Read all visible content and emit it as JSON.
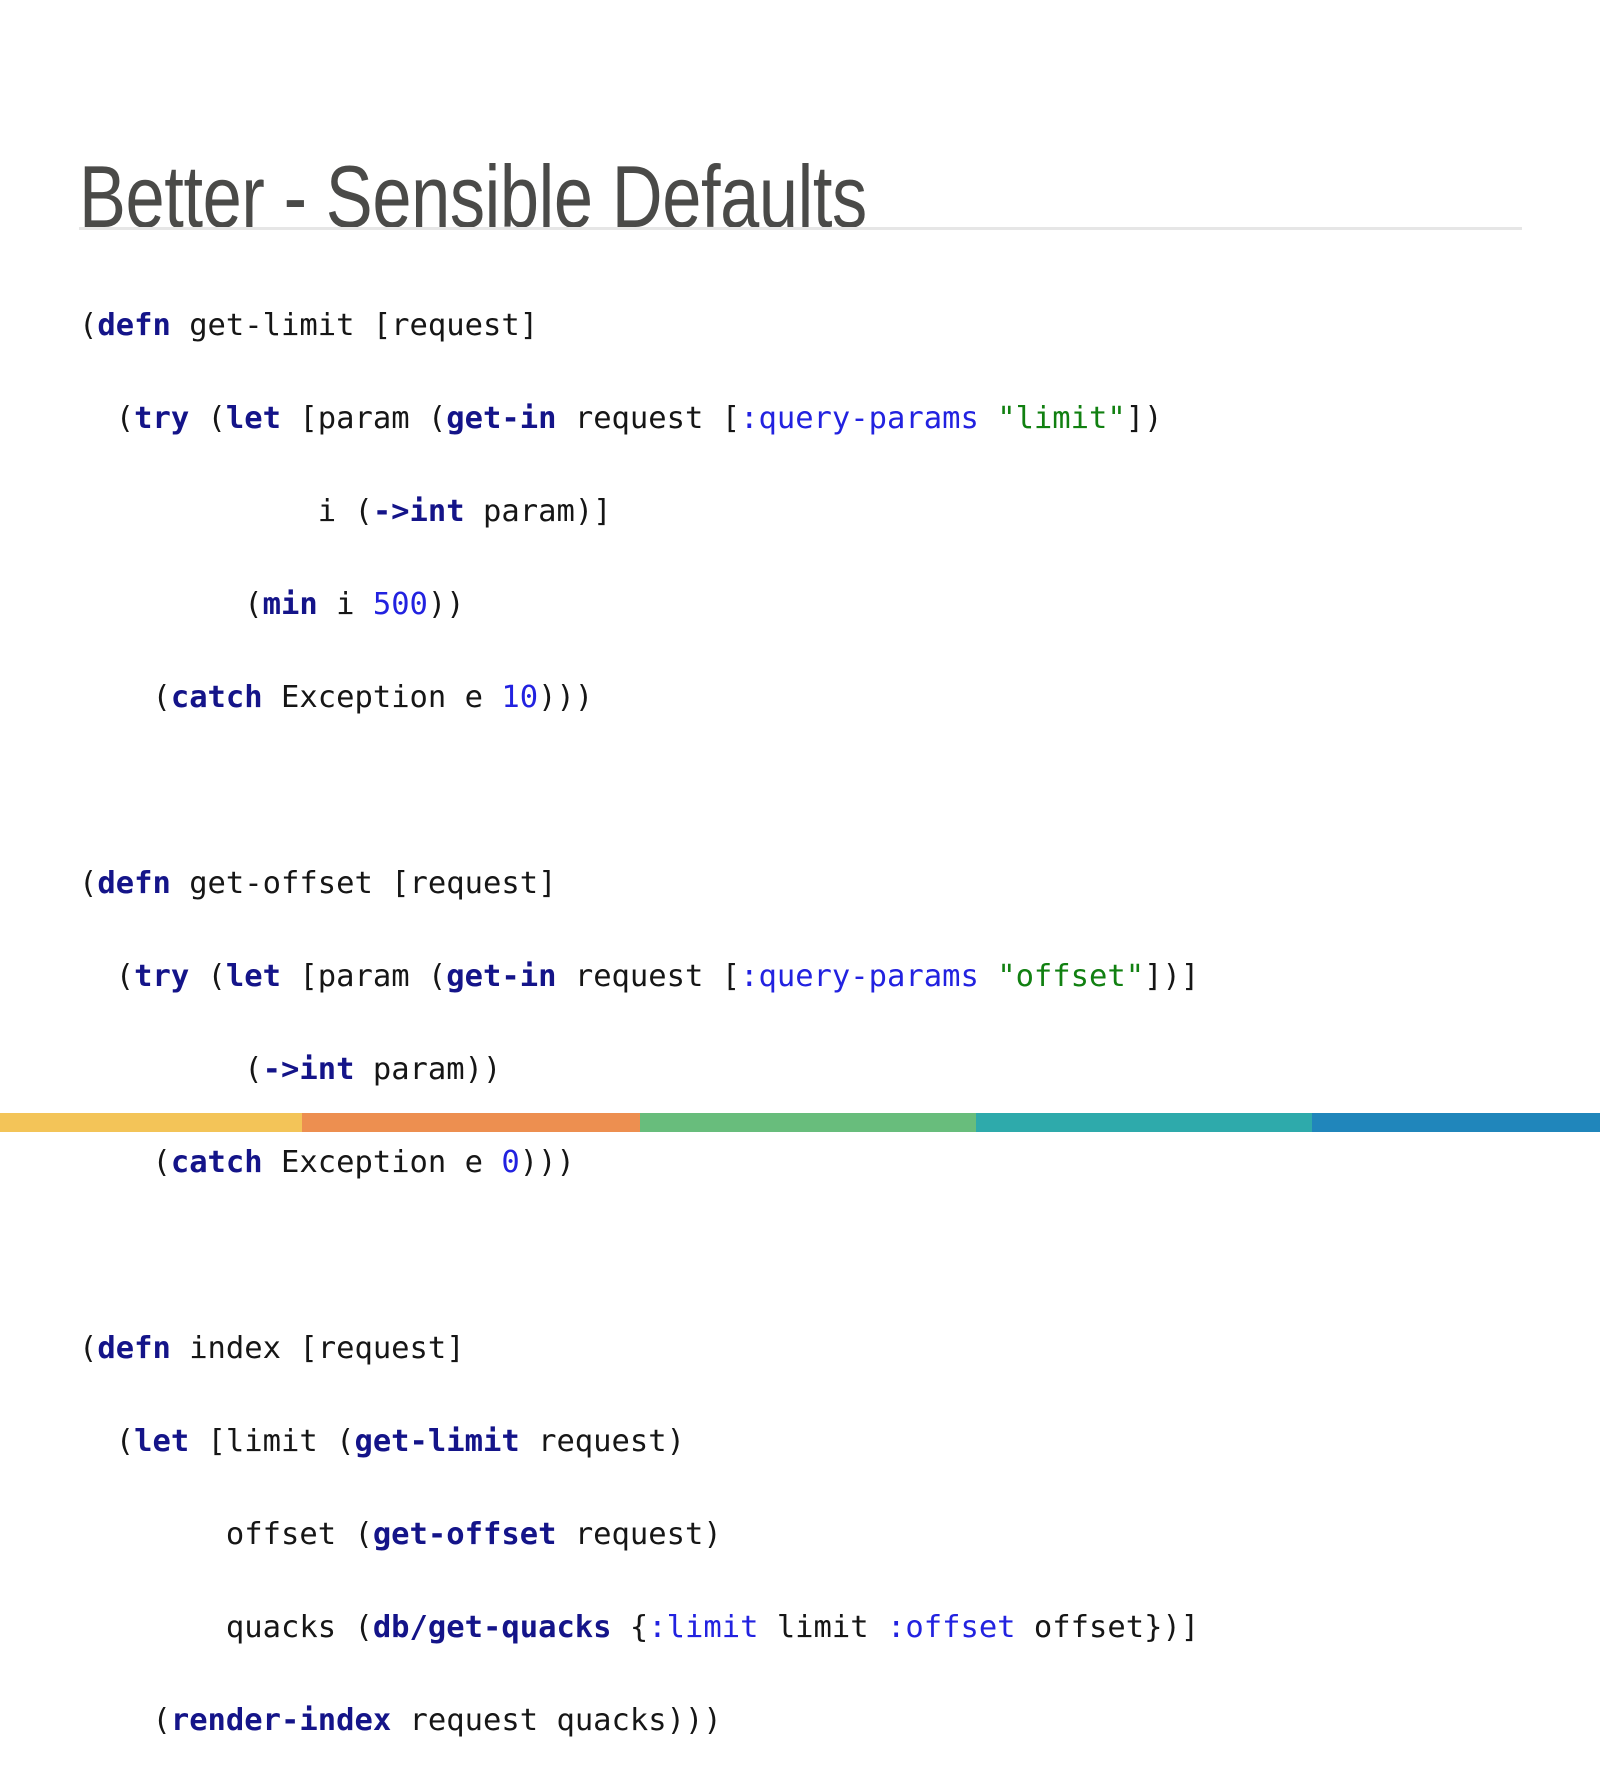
{
  "slide": {
    "title": "Better - Sensible Defaults",
    "title_color": "#4a4a48",
    "rule_color": "#e6e6e6",
    "background": "#ffffff"
  },
  "theme": {
    "keyword_bold_navy": "#141489",
    "keyword_literal_blue": "#2222e0",
    "number_blue": "#2222e0",
    "string_green": "#118011",
    "plain_text": "#161616"
  },
  "code": {
    "language": "clojure",
    "full_text": "(defn get-limit [request]\n  (try (let [param (get-in request [:query-params \"limit\"])\n             i (->int param)]\n         (min i 500))\n    (catch Exception e 10)))\n\n(defn get-offset [request]\n  (try (let [param (get-in request [:query-params \"offset\"])]\n         (->int param))\n    (catch Exception e 0)))\n\n(defn index [request]\n  (let [limit (get-limit request)\n        offset (get-offset request)\n        quacks (db/get-quacks {:limit limit :offset offset})]\n    (render-index request quacks)))",
    "lines": [
      {
        "id": "l1",
        "tokens": [
          {
            "t": "(",
            "c": "sym"
          },
          {
            "t": "defn",
            "c": "kw"
          },
          {
            "t": " get-limit [request]",
            "c": "sym"
          }
        ]
      },
      {
        "id": "l2",
        "tokens": [
          {
            "t": "  (",
            "c": "sym"
          },
          {
            "t": "try",
            "c": "kw"
          },
          {
            "t": " (",
            "c": "sym"
          },
          {
            "t": "let",
            "c": "kw"
          },
          {
            "t": " [param (",
            "c": "sym"
          },
          {
            "t": "get-in",
            "c": "kw"
          },
          {
            "t": " request [",
            "c": "sym"
          },
          {
            "t": ":query-params",
            "c": "kwd"
          },
          {
            "t": " ",
            "c": "sym"
          },
          {
            "t": "\"limit\"",
            "c": "str"
          },
          {
            "t": "])",
            "c": "sym"
          }
        ]
      },
      {
        "id": "l3",
        "tokens": [
          {
            "t": "             i (",
            "c": "sym"
          },
          {
            "t": "->int",
            "c": "kw"
          },
          {
            "t": " param)]",
            "c": "sym"
          }
        ]
      },
      {
        "id": "l4",
        "tokens": [
          {
            "t": "         (",
            "c": "sym"
          },
          {
            "t": "min",
            "c": "kw"
          },
          {
            "t": " i ",
            "c": "sym"
          },
          {
            "t": "500",
            "c": "num"
          },
          {
            "t": "))",
            "c": "sym"
          }
        ]
      },
      {
        "id": "l5",
        "tokens": [
          {
            "t": "    (",
            "c": "sym"
          },
          {
            "t": "catch",
            "c": "kw"
          },
          {
            "t": " Exception e ",
            "c": "sym"
          },
          {
            "t": "10",
            "c": "num"
          },
          {
            "t": ")))",
            "c": "sym"
          }
        ]
      },
      {
        "id": "l6",
        "tokens": []
      },
      {
        "id": "l7",
        "tokens": [
          {
            "t": "(",
            "c": "sym"
          },
          {
            "t": "defn",
            "c": "kw"
          },
          {
            "t": " get-offset [request]",
            "c": "sym"
          }
        ]
      },
      {
        "id": "l8",
        "tokens": [
          {
            "t": "  (",
            "c": "sym"
          },
          {
            "t": "try",
            "c": "kw"
          },
          {
            "t": " (",
            "c": "sym"
          },
          {
            "t": "let",
            "c": "kw"
          },
          {
            "t": " [param (",
            "c": "sym"
          },
          {
            "t": "get-in",
            "c": "kw"
          },
          {
            "t": " request [",
            "c": "sym"
          },
          {
            "t": ":query-params",
            "c": "kwd"
          },
          {
            "t": " ",
            "c": "sym"
          },
          {
            "t": "\"offset\"",
            "c": "str"
          },
          {
            "t": "])]",
            "c": "sym"
          }
        ]
      },
      {
        "id": "l9",
        "tokens": [
          {
            "t": "         (",
            "c": "sym"
          },
          {
            "t": "->int",
            "c": "kw"
          },
          {
            "t": " param))",
            "c": "sym"
          }
        ]
      },
      {
        "id": "l10",
        "tokens": [
          {
            "t": "    (",
            "c": "sym"
          },
          {
            "t": "catch",
            "c": "kw"
          },
          {
            "t": " Exception e ",
            "c": "sym"
          },
          {
            "t": "0",
            "c": "num"
          },
          {
            "t": ")))",
            "c": "sym"
          }
        ]
      },
      {
        "id": "l11",
        "tokens": []
      },
      {
        "id": "l12",
        "tokens": [
          {
            "t": "(",
            "c": "sym"
          },
          {
            "t": "defn",
            "c": "kw"
          },
          {
            "t": " index [request]",
            "c": "sym"
          }
        ]
      },
      {
        "id": "l13",
        "tokens": [
          {
            "t": "  (",
            "c": "sym"
          },
          {
            "t": "let",
            "c": "kw"
          },
          {
            "t": " [limit (",
            "c": "sym"
          },
          {
            "t": "get-limit",
            "c": "kw"
          },
          {
            "t": " request)",
            "c": "sym"
          }
        ]
      },
      {
        "id": "l14",
        "tokens": [
          {
            "t": "        offset (",
            "c": "sym"
          },
          {
            "t": "get-offset",
            "c": "kw"
          },
          {
            "t": " request)",
            "c": "sym"
          }
        ]
      },
      {
        "id": "l15",
        "tokens": [
          {
            "t": "        quacks (",
            "c": "sym"
          },
          {
            "t": "db/get-quacks",
            "c": "kw"
          },
          {
            "t": " {",
            "c": "sym"
          },
          {
            "t": ":limit",
            "c": "kwd"
          },
          {
            "t": " limit ",
            "c": "sym"
          },
          {
            "t": ":offset",
            "c": "kwd"
          },
          {
            "t": " offset})]",
            "c": "sym"
          }
        ]
      },
      {
        "id": "l16",
        "tokens": [
          {
            "t": "    (",
            "c": "sym"
          },
          {
            "t": "render-index",
            "c": "kw"
          },
          {
            "t": " request quacks)))",
            "c": "sym"
          }
        ]
      }
    ]
  },
  "footer": {
    "segments": [
      {
        "name": "yellow",
        "color": "#f3c458",
        "width_pct": 18.9
      },
      {
        "name": "orange",
        "color": "#ed8f50",
        "width_pct": 21.1
      },
      {
        "name": "green",
        "color": "#68bd7c",
        "width_pct": 21.0
      },
      {
        "name": "teal",
        "color": "#2eaaab",
        "width_pct": 21.0
      },
      {
        "name": "blue",
        "color": "#2086bb",
        "width_pct": 18.0
      }
    ]
  }
}
